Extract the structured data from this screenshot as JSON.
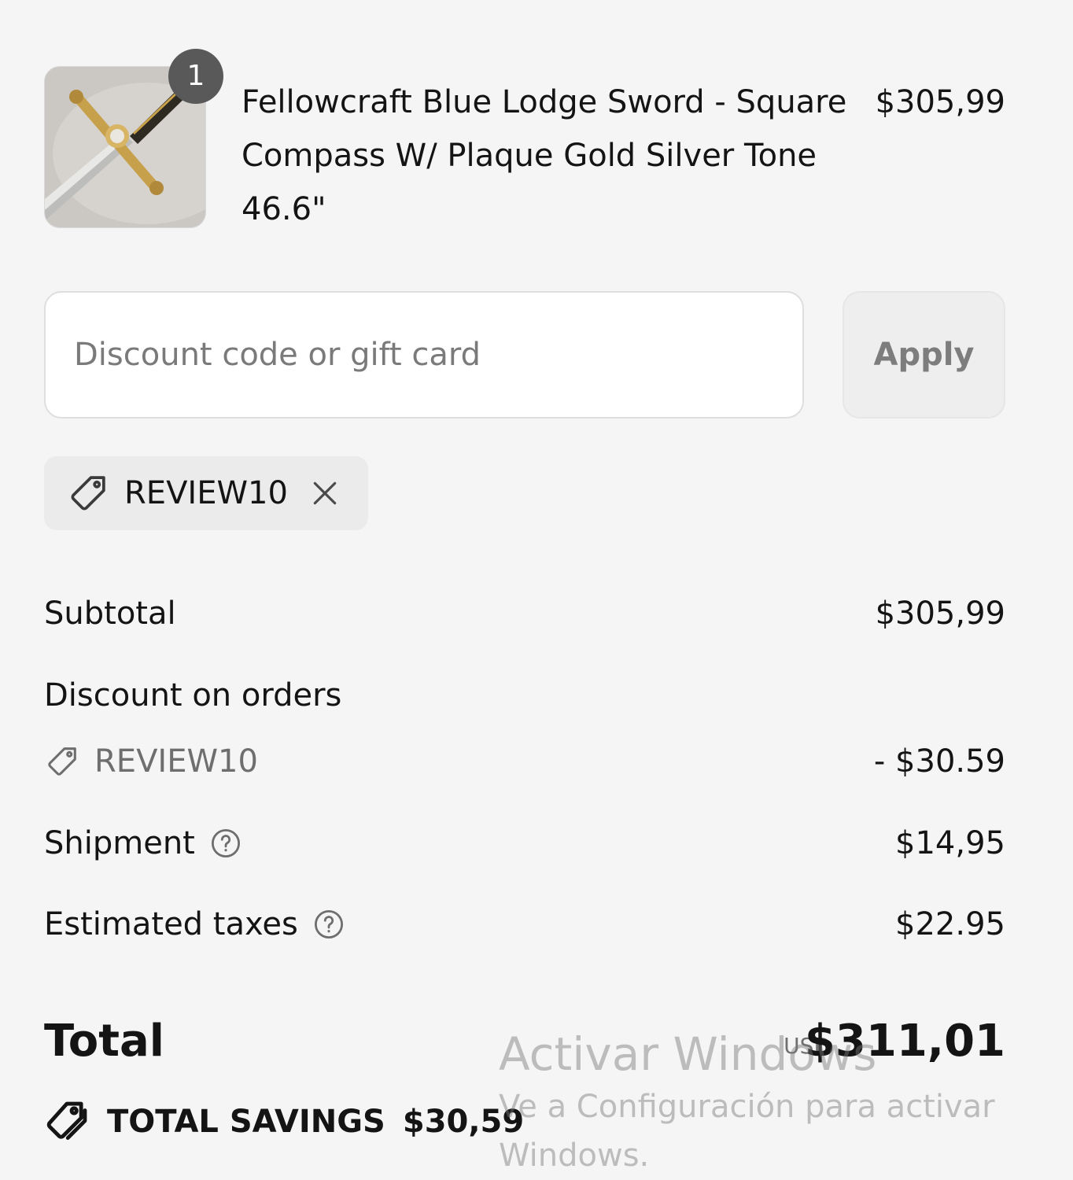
{
  "product": {
    "title": "Fellowcraft Blue Lodge Sword - Square Compass W/ Plaque Gold Silver Tone 46.6\"",
    "price": "$305,99",
    "quantity": "1",
    "image_icon": "sword-product-thumbnail"
  },
  "discount": {
    "placeholder": "Discount code or gift card",
    "value": "",
    "apply_label": "Apply",
    "applied_code": "REVIEW10"
  },
  "summary": {
    "subtotal_label": "Subtotal",
    "subtotal_value": "$305,99",
    "discount_label": "Discount on orders",
    "discount_code": "REVIEW10",
    "discount_value": "- $30.59",
    "shipment_label": "Shipment",
    "shipment_value": "$14,95",
    "taxes_label": "Estimated taxes",
    "taxes_value": "$22.95",
    "total_label": "Total",
    "total_currency": "USD",
    "total_value": "$311,01",
    "savings_label": "TOTAL SAVINGS",
    "savings_value": "$30,59"
  },
  "watermark": {
    "title": "Activar Windows",
    "subtitle": "Ve a Configuración para activar Windows."
  },
  "colors": {
    "background": "#f5f5f5",
    "text": "#141414",
    "muted": "#6e6e6e",
    "badge": "#595959"
  }
}
